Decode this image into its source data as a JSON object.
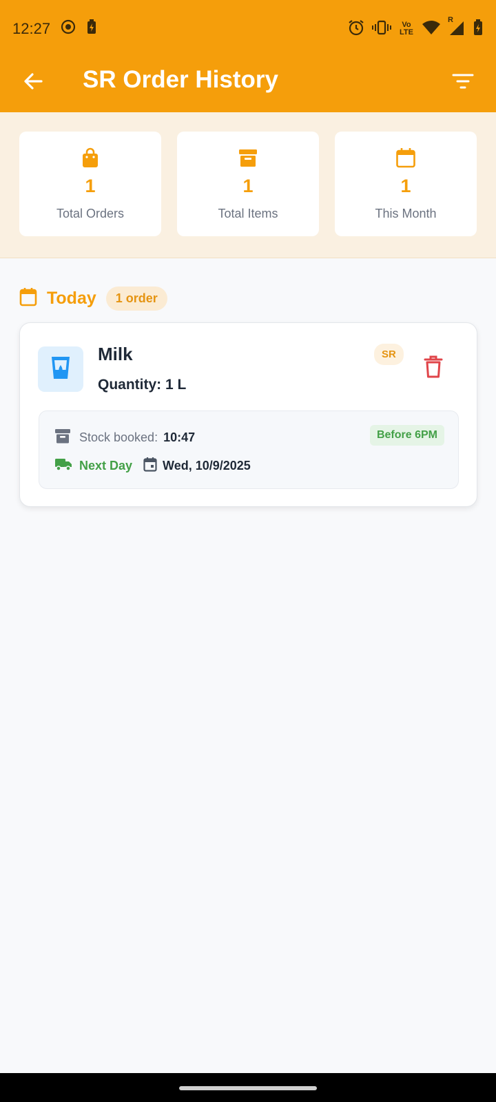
{
  "status_bar": {
    "time": "12:27",
    "left_icons": [
      "record-icon",
      "battery-saver-icon"
    ],
    "right_icons": [
      "alarm-icon",
      "vibrate-icon",
      "volte-icon",
      "wifi-icon",
      "signal-roaming-icon",
      "battery-charging-icon"
    ],
    "volte_label": "Vo LTE",
    "roaming_label": "R"
  },
  "app_bar": {
    "title": "SR Order History",
    "back_icon": "arrow-back-icon",
    "filter_icon": "filter-icon",
    "background": "#f59e0b"
  },
  "stats": [
    {
      "icon": "shopping-bag-icon",
      "value": "1",
      "label": "Total Orders"
    },
    {
      "icon": "archive-box-icon",
      "value": "1",
      "label": "Total Items"
    },
    {
      "icon": "calendar-icon",
      "value": "1",
      "label": "This Month"
    }
  ],
  "section": {
    "icon": "calendar-icon",
    "label": "Today",
    "count_label": "1 order"
  },
  "order": {
    "product_icon": "drink-glass-icon",
    "name": "Milk",
    "quantity": "Quantity: 1 L",
    "badge": "SR",
    "delete_icon": "trash-icon",
    "stock_label": "Stock booked:",
    "stock_time": "10:47",
    "cutoff_badge": "Before 6PM",
    "delivery_label": "Next Day",
    "delivery_date": "Wed, 10/9/2025"
  },
  "colors": {
    "accent": "#f59e0b",
    "success": "#43a047",
    "danger": "#e0454a",
    "info": "#2196f3"
  }
}
